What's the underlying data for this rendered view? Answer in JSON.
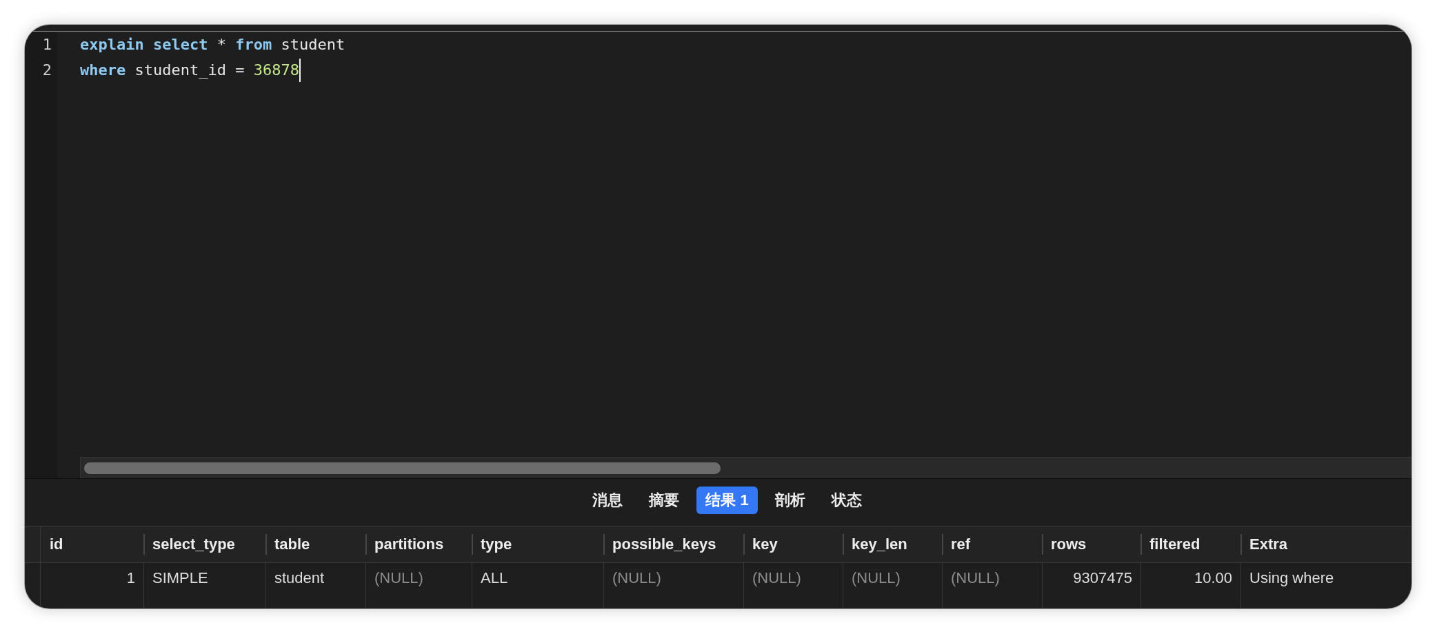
{
  "editor": {
    "lines": [
      {
        "number": "1",
        "cursor": false,
        "tokens": [
          {
            "kind": "keyword",
            "text": "explain"
          },
          {
            "kind": "keyword",
            "text": " select"
          },
          {
            "kind": "plain",
            "text": " * "
          },
          {
            "kind": "keyword",
            "text": "from"
          },
          {
            "kind": "plain",
            "text": " student"
          }
        ]
      },
      {
        "number": "2",
        "cursor": true,
        "tokens": [
          {
            "kind": "keyword",
            "text": "where"
          },
          {
            "kind": "plain",
            "text": " student_id = "
          },
          {
            "kind": "number",
            "text": "36878"
          }
        ]
      }
    ]
  },
  "tabs": [
    {
      "label": "消息",
      "selected": false
    },
    {
      "label": "摘要",
      "selected": false
    },
    {
      "label": "结果 1",
      "selected": true
    },
    {
      "label": "剖析",
      "selected": false
    },
    {
      "label": "状态",
      "selected": false
    }
  ],
  "table": {
    "columns": [
      "id",
      "select_type",
      "table",
      "partitions",
      "type",
      "possible_keys",
      "key",
      "key_len",
      "ref",
      "rows",
      "filtered",
      "Extra"
    ],
    "rows": [
      {
        "cells": [
          {
            "kind": "number",
            "text": "1"
          },
          {
            "kind": "text",
            "text": "SIMPLE"
          },
          {
            "kind": "text",
            "text": "student"
          },
          {
            "kind": "null",
            "text": "(NULL)"
          },
          {
            "kind": "text",
            "text": "ALL"
          },
          {
            "kind": "null",
            "text": "(NULL)"
          },
          {
            "kind": "null",
            "text": "(NULL)"
          },
          {
            "kind": "null",
            "text": "(NULL)"
          },
          {
            "kind": "null",
            "text": "(NULL)"
          },
          {
            "kind": "number",
            "text": "9307475"
          },
          {
            "kind": "number",
            "text": "10.00"
          },
          {
            "kind": "text",
            "text": "Using where"
          }
        ]
      }
    ]
  }
}
